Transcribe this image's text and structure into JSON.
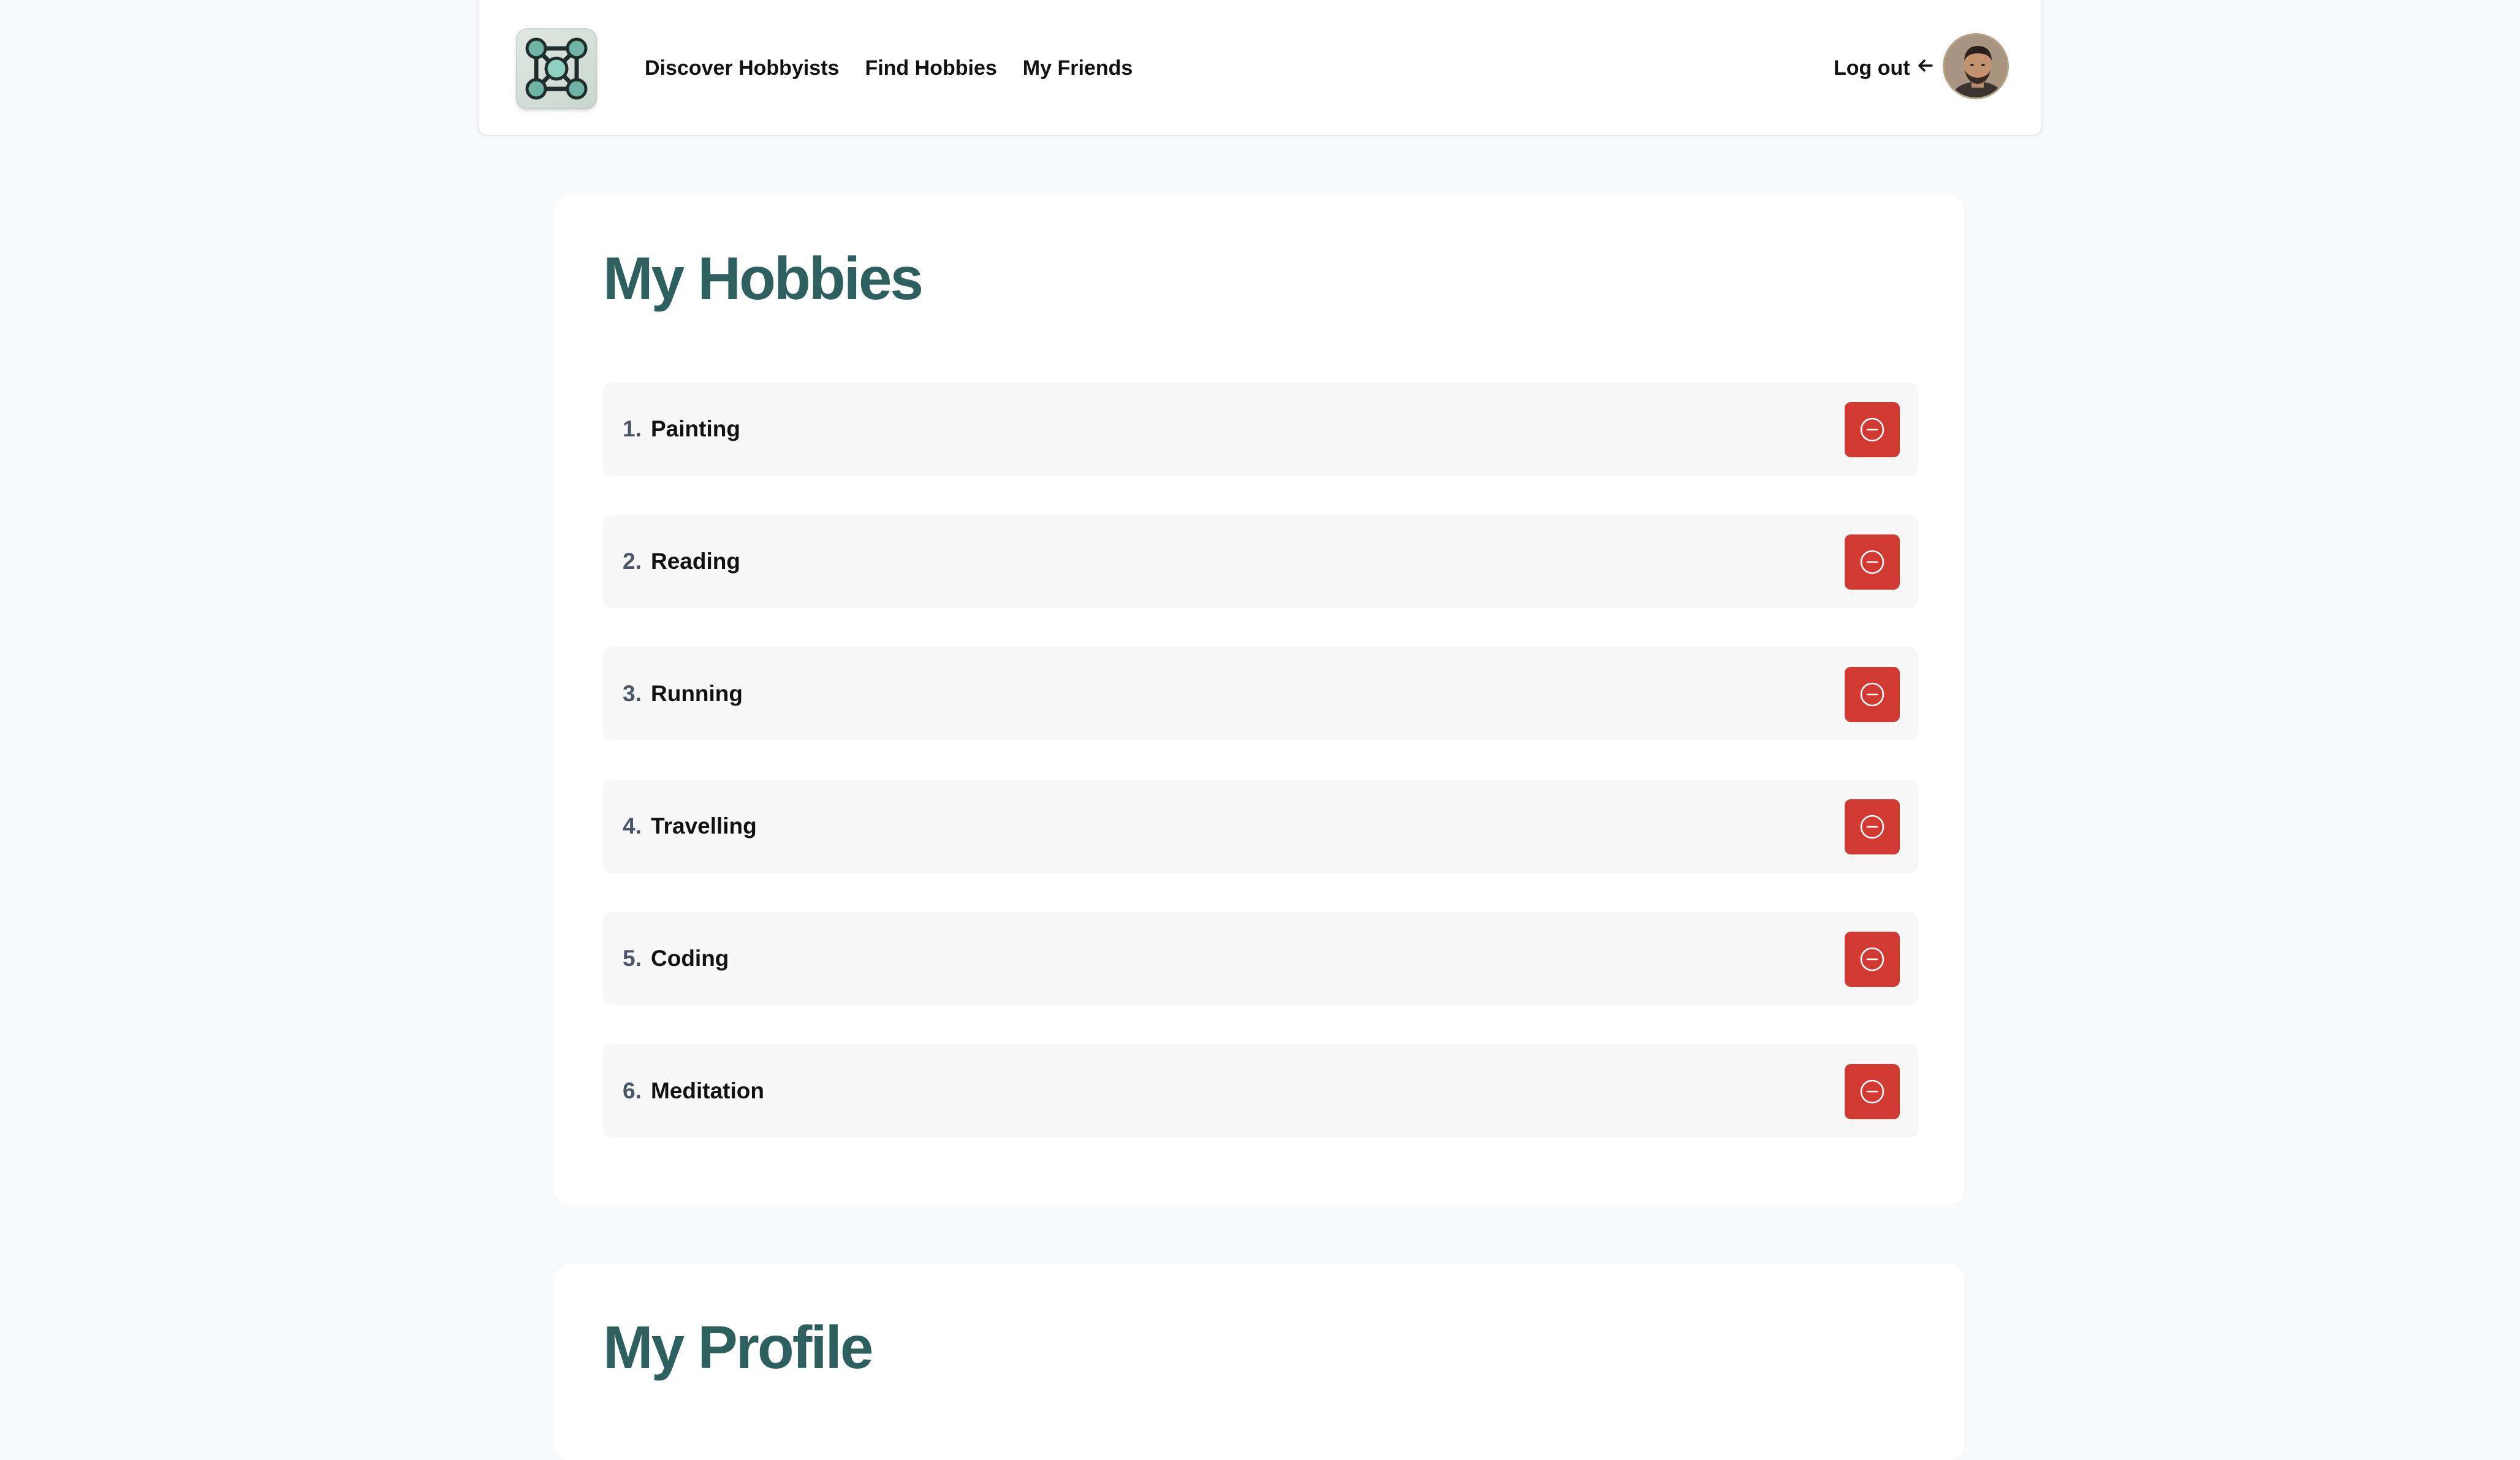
{
  "app": {
    "logo_icon": "molecule-network-icon"
  },
  "nav": {
    "links": [
      {
        "label": "Discover Hobbyists"
      },
      {
        "label": "Find Hobbies"
      },
      {
        "label": "My Friends"
      }
    ],
    "logout_label": "Log out",
    "logout_icon": "arrow-left-icon",
    "avatar_icon": "user-avatar"
  },
  "hobbies_section": {
    "title": "My Hobbies",
    "items": [
      {
        "number": "1.",
        "name": "Painting"
      },
      {
        "number": "2.",
        "name": "Reading"
      },
      {
        "number": "3.",
        "name": "Running"
      },
      {
        "number": "4.",
        "name": "Travelling"
      },
      {
        "number": "5.",
        "name": "Coding"
      },
      {
        "number": "6.",
        "name": "Meditation"
      }
    ],
    "remove_icon": "minus-circle-icon"
  },
  "profile_section": {
    "title": "My Profile"
  },
  "colors": {
    "accent_heading": "#2c5f5d",
    "danger": "#d13a33",
    "page_bg": "#f8f9fb"
  }
}
